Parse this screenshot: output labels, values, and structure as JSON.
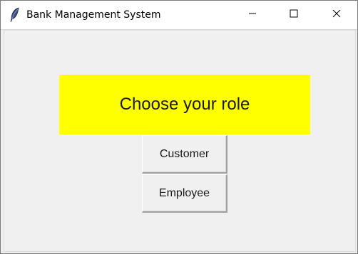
{
  "window": {
    "title": "Bank Management System",
    "app_icon": "feather-icon",
    "controls": {
      "minimize": "minimize-icon",
      "maximize": "maximize-icon",
      "close": "close-icon"
    }
  },
  "main": {
    "banner_text": "Choose your role",
    "banner_color": "#ffff00",
    "buttons": {
      "customer_label": "Customer",
      "employee_label": "Employee"
    }
  }
}
